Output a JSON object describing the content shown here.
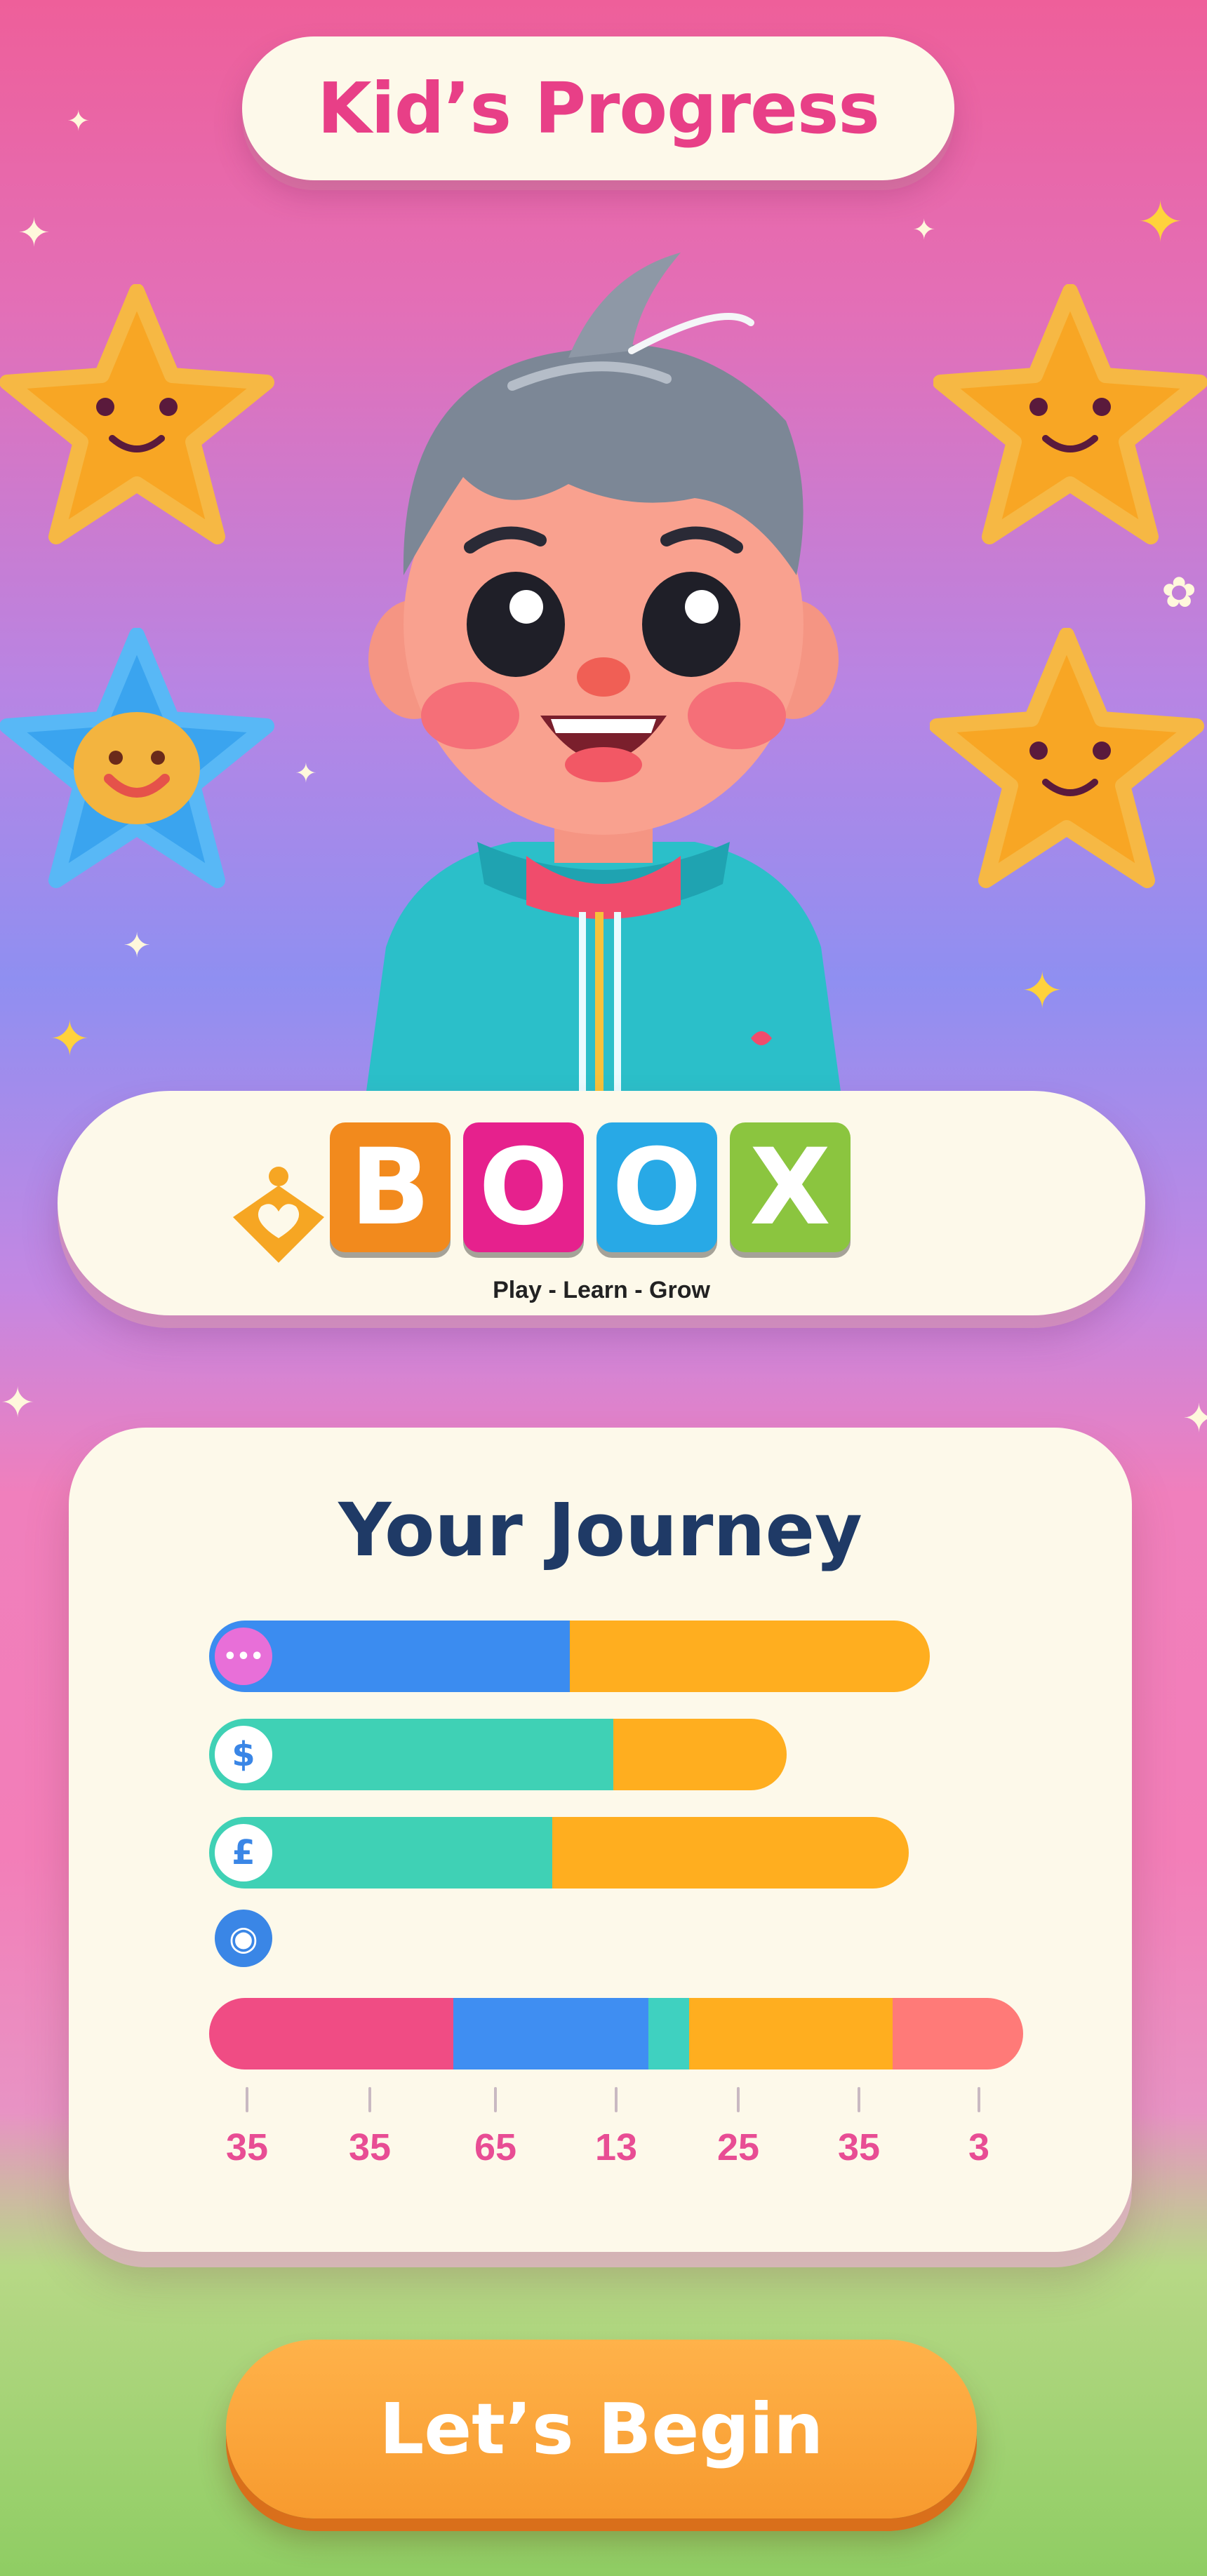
{
  "header": {
    "title": "Kid’s Progress"
  },
  "brand": {
    "letters": [
      "B",
      "O",
      "O",
      "X"
    ],
    "tile_colors": [
      "#f28a1d",
      "#e6218d",
      "#28a9e6",
      "#8bc53f"
    ],
    "tagline": "Play - Learn - Grow"
  },
  "journey": {
    "title": "Your Journey",
    "bars": [
      {
        "icon": "dots-icon",
        "icon_glyph": "•••",
        "segments": [
          {
            "color": "#3b8cf0",
            "fraction": 0.5
          },
          {
            "color": "#ffae1f",
            "fraction": 0.5
          }
        ]
      },
      {
        "icon": "dollar-icon",
        "icon_glyph": "$",
        "segments": [
          {
            "color": "#3fd1b5",
            "fraction": 0.7
          },
          {
            "color": "#ffae1f",
            "fraction": 0.3
          }
        ]
      },
      {
        "icon": "pound-icon",
        "icon_glyph": "£",
        "segments": [
          {
            "color": "#3fd1b5",
            "fraction": 0.49
          },
          {
            "color": "#ffae1f",
            "fraction": 0.51
          }
        ]
      },
      {
        "icon": "globe-icon",
        "icon_glyph": "◉",
        "segments": []
      },
      {
        "icon": "",
        "icon_glyph": "",
        "segments": [
          {
            "color": "#f04c84",
            "fraction": 0.3
          },
          {
            "color": "#3f8ef2",
            "fraction": 0.24
          },
          {
            "color": "#3fd1c0",
            "fraction": 0.05
          },
          {
            "color": "#ffae1f",
            "fraction": 0.25
          },
          {
            "color": "#ff7a78",
            "fraction": 0.16
          }
        ]
      }
    ],
    "axis_labels": [
      "35",
      "35",
      "65",
      "13",
      "25",
      "35",
      "3"
    ]
  },
  "cta": {
    "label": "Let’s Begin"
  },
  "colors": {
    "title_pink": "#e83f87",
    "journey_navy": "#1f3a66",
    "cta_orange": "#f79a2e"
  }
}
